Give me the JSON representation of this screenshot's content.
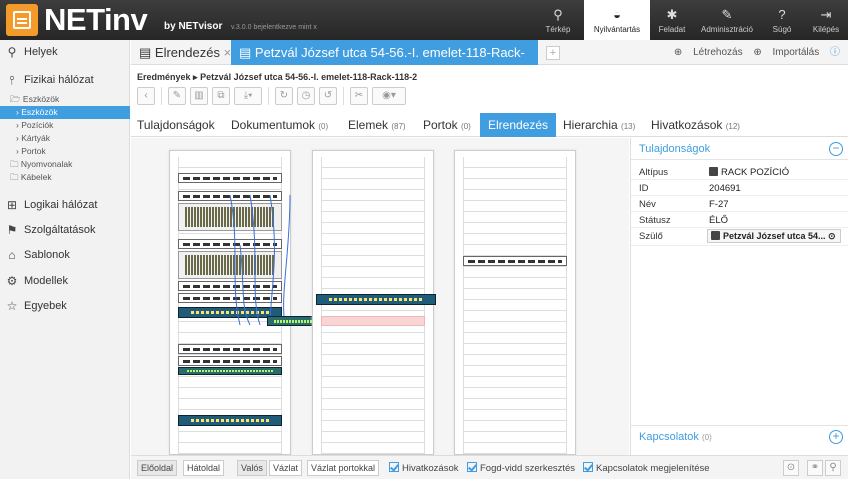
{
  "app": {
    "name": "NETinv",
    "by": "by NETvisor",
    "version": "v.3.0.0",
    "hint": "bejelentkezve mint x"
  },
  "topnav": [
    {
      "label": "Térkép",
      "icon": "map-pin-icon",
      "glyph": "⚲"
    },
    {
      "label": "Nyilvántartás",
      "icon": "inventory-icon",
      "glyph": "◒"
    },
    {
      "label": "Feladat",
      "icon": "gear-icon",
      "glyph": "✱"
    },
    {
      "label": "Adminisztráció",
      "icon": "wrench-icon",
      "glyph": "✎"
    },
    {
      "label": "Súgó",
      "icon": "help-icon",
      "glyph": "?"
    },
    {
      "label": "Kilépés",
      "icon": "logout-icon",
      "glyph": "⇥"
    }
  ],
  "sidebar": {
    "items": [
      {
        "label": "Helyek",
        "icon": "location-pin-icon",
        "glyph": "⚲"
      },
      {
        "label": "Fizikai hálózat",
        "icon": "physical-network-icon",
        "glyph": "⫯"
      },
      {
        "label": "Logikai hálózat",
        "icon": "logical-network-icon",
        "glyph": "⊞"
      },
      {
        "label": "Szolgáltatások",
        "icon": "services-icon",
        "glyph": "⚑"
      },
      {
        "label": "Sablonok",
        "icon": "templates-icon",
        "glyph": "⌂"
      },
      {
        "label": "Modellek",
        "icon": "models-icon",
        "glyph": "⚙"
      },
      {
        "label": "Egyebek",
        "icon": "star-icon",
        "glyph": "☆"
      }
    ],
    "sub": [
      "Eszközök",
      "Eszközök",
      "Pozíciók",
      "Kártyák",
      "Portok",
      "Nyomvonalak",
      "Kábelek"
    ]
  },
  "tabs": {
    "first": "Elrendezés",
    "second": "Petzvál József utca 54-56.-I. emelet-118-Rack-118-2",
    "create": "Létrehozás",
    "import": "Importálás"
  },
  "breadcrumb": {
    "root": "Eredmények",
    "current": "Petzvál József utca 54-56.-I. emelet-118-Rack-118-2"
  },
  "subtabs": [
    {
      "label": "Tulajdonságok",
      "count": ""
    },
    {
      "label": "Dokumentumok",
      "count": "(0)"
    },
    {
      "label": "Elemek",
      "count": "(87)"
    },
    {
      "label": "Portok",
      "count": "(0)"
    },
    {
      "label": "Elrendezés",
      "count": ""
    },
    {
      "label": "Hierarchia",
      "count": "(13)"
    },
    {
      "label": "Hivatkozások",
      "count": "(12)"
    }
  ],
  "properties": {
    "title": "Tulajdonságok",
    "rows": [
      {
        "key": "Altípus",
        "value": "RACK POZÍCIÓ"
      },
      {
        "key": "ID",
        "value": "204691"
      },
      {
        "key": "Név",
        "value": "F-27"
      },
      {
        "key": "Státusz",
        "value": "ÉLŐ"
      },
      {
        "key": "Szülő",
        "value": "Petzvál József utca 54..."
      }
    ],
    "connections": "Kapcsolatok",
    "connections_count": "(0)"
  },
  "bottombar": {
    "front": "Előoldal",
    "back": "Hátoldal",
    "real": "Valós",
    "sketch": "Vázlat",
    "sketch_ports": "Vázlat portokkal",
    "cb1": "Hivatkozások",
    "cb2": "Fogd-vidd szerkesztés",
    "cb3": "Kapcsolatok megjelenítése"
  },
  "colors": {
    "accent": "#3f9de0",
    "brand": "#f39a2a",
    "topbar": "#2e2e2e"
  }
}
